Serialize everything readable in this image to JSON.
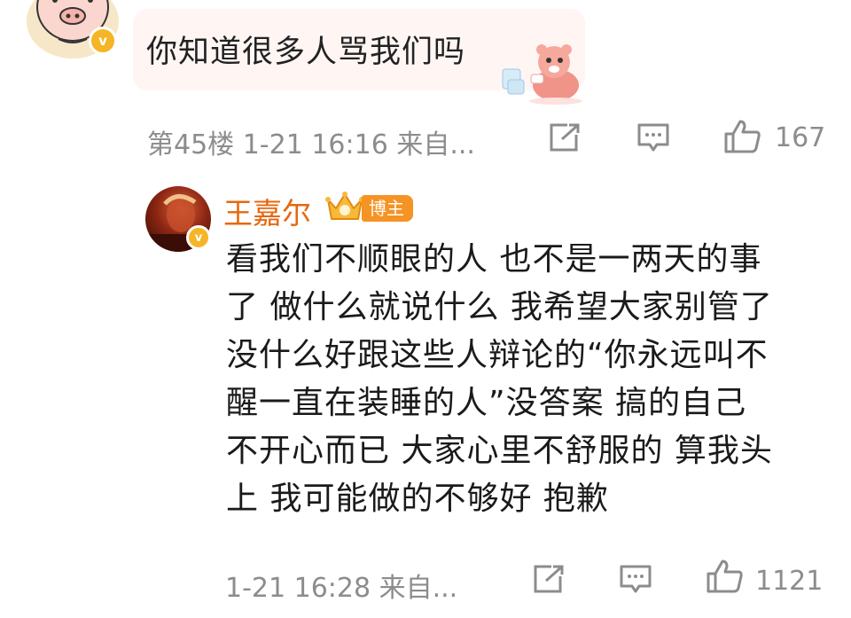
{
  "comment": {
    "text": "你知道很多人骂我们吗",
    "verified_badge": "v",
    "meta": "第45楼 1-21 16:16 来自...",
    "like_count": "167"
  },
  "reply": {
    "author": "王嘉尔",
    "tag": "博主",
    "verified_badge": "v",
    "lines": [
      "看我们不顺眼的人 也不是一两天的事",
      "了 做什么就说什么 我希望大家别管了",
      "没什么好跟这些人辩论的“你永远叫不",
      "醒一直在装睡的人”没答案 搞的自己",
      "不开心而已 大家心里不舒服的 算我头",
      "上 我可能做的不够好 抱歉"
    ],
    "meta": "1-21 16:28 来自...",
    "like_count": "1121"
  },
  "icons": [
    "share-icon",
    "comment-icon",
    "thumbs-up-icon"
  ],
  "colors": {
    "author": "#e8670c",
    "tag_bg": "#f59324",
    "badge": "#f6b526",
    "meta": "#8c8c8c"
  }
}
